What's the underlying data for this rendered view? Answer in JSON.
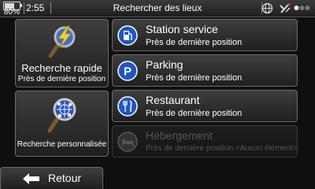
{
  "status_bar": {
    "battery_percent": "80%",
    "time": "2:55",
    "title": "Rechercher des lieux",
    "icons": [
      "battery-icon",
      "globe-icon",
      "satellite-icon",
      "page-dots-icon"
    ]
  },
  "tiles": {
    "quick_search": {
      "title": "Recherche rapide",
      "subtitle": "Près de dernière position",
      "icon": "magnifier-lightning-icon"
    },
    "custom_search": {
      "title": "Recherche personnalisée",
      "icon": "magnifier-globe-icon"
    }
  },
  "list": [
    {
      "title": "Station service",
      "subtitle": "Près de dernière position",
      "icon": "fuel-pump-icon",
      "enabled": true
    },
    {
      "title": "Parking",
      "subtitle": "Près de dernière position",
      "icon": "parking-icon",
      "enabled": true
    },
    {
      "title": "Restaurant",
      "subtitle": "Près de dernière position",
      "icon": "fork-knife-icon",
      "enabled": true
    },
    {
      "title": "Hébergement",
      "subtitle": "Près de dernière position <Aucun élément>",
      "icon": "bed-icon",
      "enabled": false
    }
  ],
  "back_button": {
    "label": "Retour",
    "icon": "back-arrow-icon"
  },
  "colors": {
    "accent_blue": "#1e56c4",
    "background": "#0f0f0f",
    "tile": "#2e2e2e",
    "disabled_text": "#555555"
  }
}
